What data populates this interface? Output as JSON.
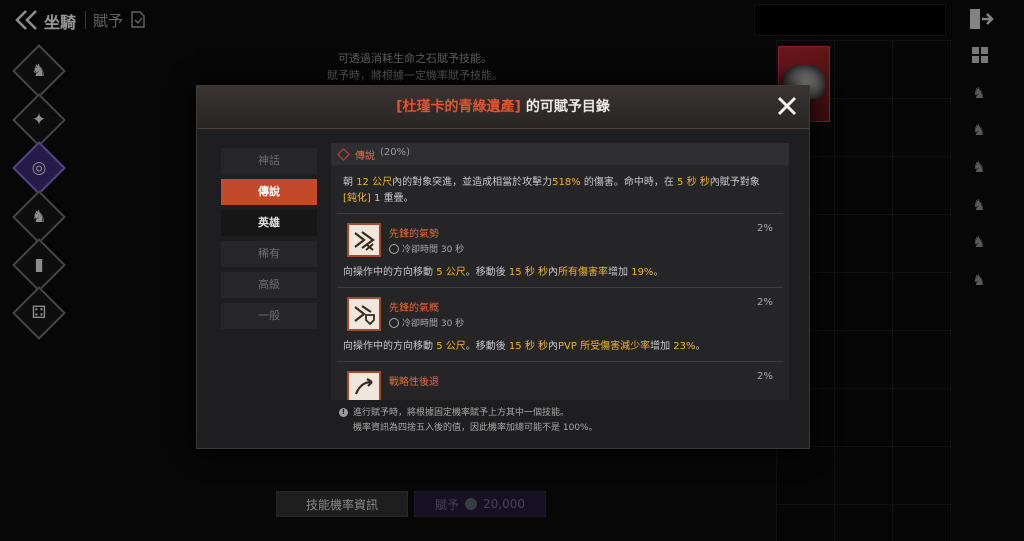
{
  "header": {
    "title": "坐騎",
    "subtitle": "賦予"
  },
  "background": {
    "info_lines": [
      "可透過消耗生命之石賦予技能。",
      "賦予時，將根據一定機率賦予技能。"
    ],
    "sidebar_icons": [
      "horse-head-icon",
      "four-point-star-icon",
      "spiral-rune-icon",
      "dragon-head-icon",
      "book-icon",
      "dice-icon"
    ],
    "right_icons": [
      "mount-slot-icon",
      "mount-slot-icon",
      "mount-slot-icon",
      "mount-slot-icon",
      "mount-slot-icon",
      "mount-slot-icon"
    ],
    "skill_info_button": "技能機率資訊",
    "grant_button": {
      "label": "賦予",
      "cost": "20,000"
    }
  },
  "modal": {
    "title_highlight": "[杜瑾卡的青綠遺產]",
    "title_rest": " 的可賦予目錄",
    "tabs": [
      {
        "label": "神話",
        "state": "disabled"
      },
      {
        "label": "傳說",
        "state": "active"
      },
      {
        "label": "英雄",
        "state": "enabled"
      },
      {
        "label": "稀有",
        "state": "disabled"
      },
      {
        "label": "高級",
        "state": "disabled"
      },
      {
        "label": "一般",
        "state": "disabled"
      }
    ],
    "grade": {
      "name": "傳說",
      "percent": "(20%)"
    },
    "grade_desc": {
      "p1": "朝 ",
      "v1": "12 公尺",
      "p2": "內的對象突進，並造成相當於攻擊力",
      "v2": "518%",
      "p3": " 的傷害。命中時，在 ",
      "v3": "5 秒 秒",
      "p4": "內賦予對象",
      "v4": "[鈍化]",
      "p5": " 1 重疊。"
    },
    "skills": [
      {
        "name": "先鋒的氣勢",
        "cooldown": "冷卻時間 30 秒",
        "percent": "2%",
        "desc": {
          "p1": "向操作中的方向移動 ",
          "v1": "5 公尺",
          "p2": "。移動後 ",
          "v2": "15 秒 秒",
          "p3": "內",
          "v3": "所有傷害率",
          "p4": "增加 ",
          "v4": "19%",
          "p5": "。"
        }
      },
      {
        "name": "先鋒的氣概",
        "cooldown": "冷卻時間 30 秒",
        "percent": "2%",
        "desc": {
          "p1": "向操作中的方向移動 ",
          "v1": "5 公尺",
          "p2": "。移動後 ",
          "v2": "15 秒 秒",
          "p3": "內",
          "v3": "PVP 所受傷害減少率",
          "p4": "增加 ",
          "v4": "23%",
          "p5": "。"
        }
      },
      {
        "name": "戰略性後退",
        "cooldown": "",
        "percent": "2%",
        "desc": null
      }
    ],
    "footnote": [
      "進行賦予時，將根據固定機率賦予上方其中一個技能。",
      "機率資訊為四捨五入後的值，因此機率加總可能不是 100%。"
    ]
  }
}
